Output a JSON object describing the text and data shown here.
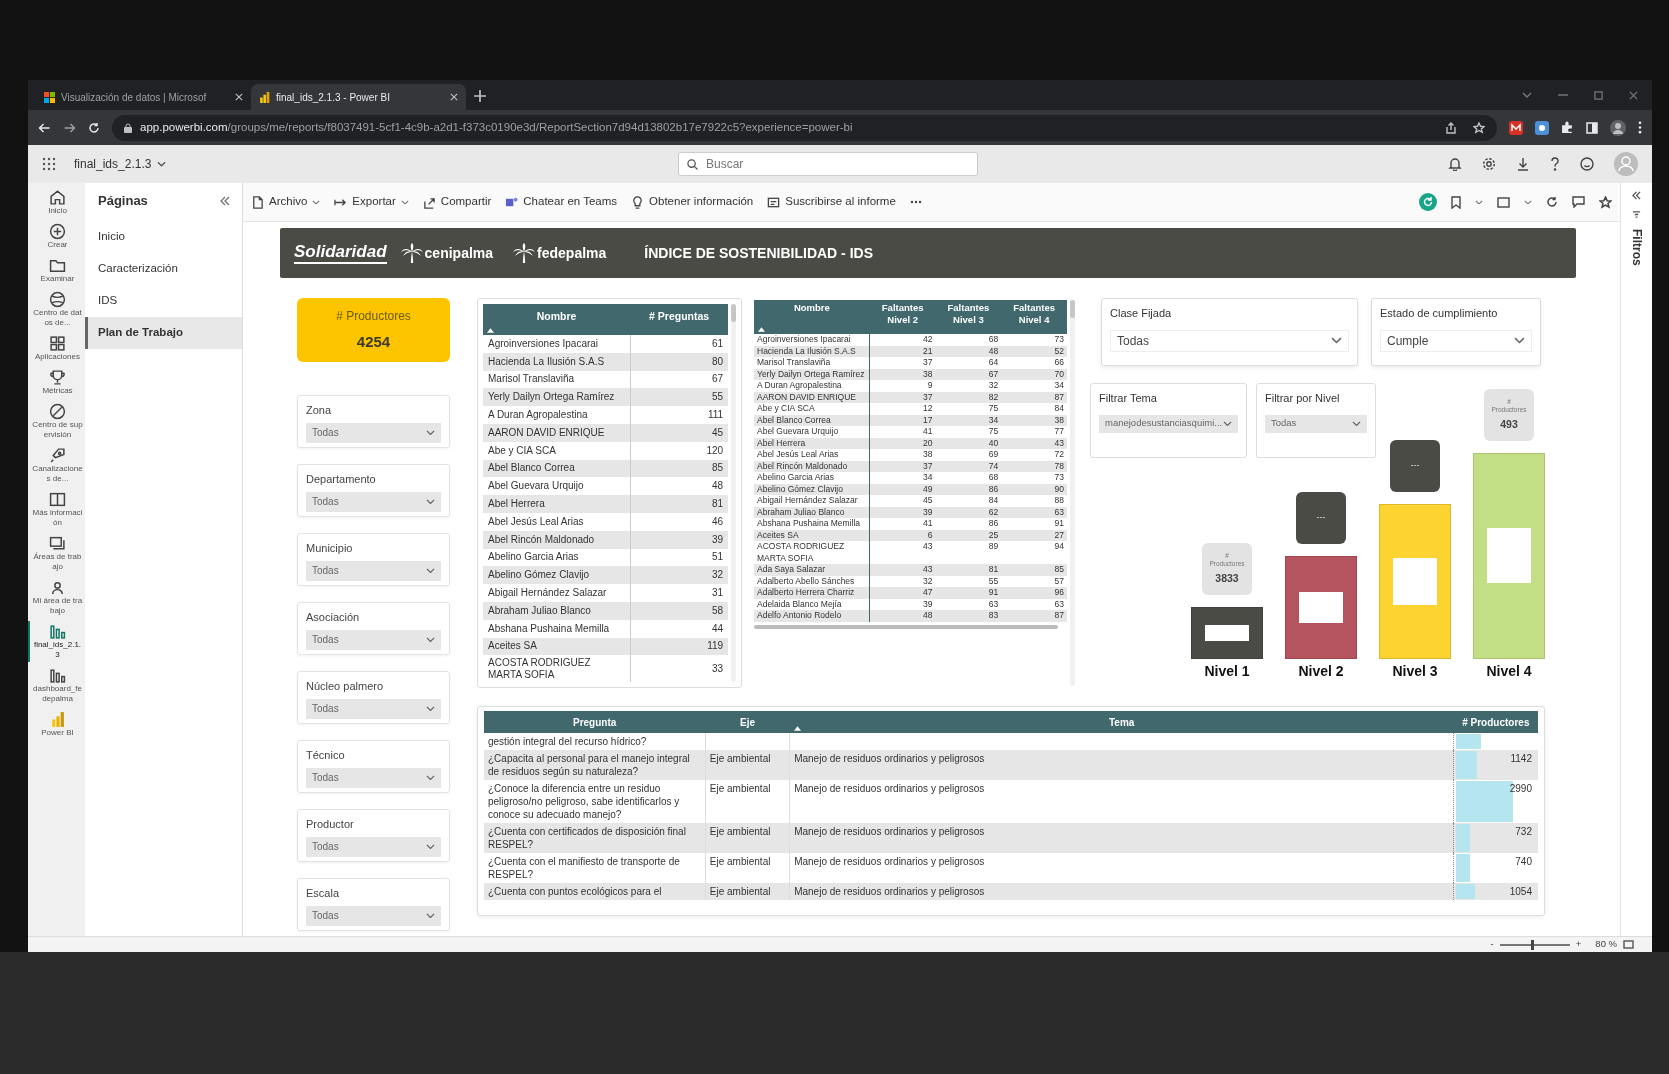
{
  "browser": {
    "tabs": [
      {
        "title": "Visualización de datos | Microsof",
        "selected": false
      },
      {
        "title": "final_ids_2.1.3 - Power BI",
        "selected": true
      }
    ],
    "address": {
      "host": "app.powerbi.com",
      "path": "/groups/me/reports/f8037491-5cf1-4c9b-a2d1-f373c0190e3d/ReportSection7d94d13802b17e7922c5?experience=power-bi"
    }
  },
  "app_header": {
    "report_title": "final_ids_2.1.3",
    "search": {
      "placeholder": "Buscar"
    }
  },
  "nav_rail": [
    {
      "label": "Inicio",
      "selected": false
    },
    {
      "label": "Crear",
      "selected": false
    },
    {
      "label": "Examinar",
      "selected": false
    },
    {
      "label": "Centro de datos de...",
      "selected": false
    },
    {
      "label": "Aplicaciones",
      "selected": false
    },
    {
      "label": "Métricas",
      "selected": false
    },
    {
      "label": "Centro de supervisión",
      "selected": false
    },
    {
      "label": "Canalizaciones de...",
      "selected": false
    },
    {
      "label": "Más información",
      "selected": false
    },
    {
      "label": "Áreas de trabajo",
      "selected": false
    },
    {
      "label": "Mi área de trabajo",
      "selected": false
    },
    {
      "label": "final_ids_2.1.3",
      "selected": true
    },
    {
      "label": "dashboard_fedepalma",
      "selected": false
    },
    {
      "label": "Power BI",
      "selected": false
    }
  ],
  "pages": {
    "title": "Páginas",
    "items": [
      {
        "label": "Inicio",
        "selected": false
      },
      {
        "label": "Caracterización",
        "selected": false
      },
      {
        "label": "IDS",
        "selected": false
      },
      {
        "label": "Plan de Trabajo",
        "selected": true
      }
    ]
  },
  "toolbar": [
    {
      "label": "Archivo",
      "dropdown": true
    },
    {
      "label": "Exportar",
      "dropdown": true
    },
    {
      "label": "Compartir",
      "dropdown": false
    },
    {
      "label": "Chatear en Teams",
      "dropdown": false
    },
    {
      "label": "Obtener información",
      "dropdown": false
    },
    {
      "label": "Suscribirse al informe",
      "dropdown": false
    }
  ],
  "report": {
    "brands": [
      "Solidaridad",
      "cenipalma",
      "fedepalma"
    ],
    "title": "ÍNDICE DE SOSTENIBILIDAD - IDS",
    "kpi": {
      "label": "# Productores",
      "value": "4254"
    },
    "left_slicers": [
      {
        "label": "Zona",
        "value": "Todas"
      },
      {
        "label": "Departamento",
        "value": "Todas"
      },
      {
        "label": "Municipio",
        "value": "Todas"
      },
      {
        "label": "Asociación",
        "value": "Todas"
      },
      {
        "label": "Núcleo palmero",
        "value": "Todas"
      },
      {
        "label": "Técnico",
        "value": "Todas"
      },
      {
        "label": "Productor",
        "value": "Todas"
      },
      {
        "label": "Escala",
        "value": "Todas"
      }
    ],
    "questions_table": {
      "columns": [
        {
          "label": "Nombre",
          "sorted": true
        },
        {
          "label": "# Preguntas",
          "sorted": false
        }
      ],
      "rows": [
        [
          "Agroinversiones Ipacarai",
          "61"
        ],
        [
          "Hacienda La Ilusión S.A.S",
          "80"
        ],
        [
          "Marisol Translaviña",
          "67"
        ],
        [
          "Yerly Dailyn Ortega Ramírez",
          "55"
        ],
        [
          "A Duran Agropalestina",
          "111"
        ],
        [
          "AARON DAVID ENRIQUE",
          "45"
        ],
        [
          "Abe y CIA SCA",
          "120"
        ],
        [
          "Abel Blanco Correa",
          "85"
        ],
        [
          "Abel Guevara Urquijo",
          "48"
        ],
        [
          "Abel Herrera",
          "81"
        ],
        [
          "Abel Jesús Leal Arias",
          "46"
        ],
        [
          "Abel Rincón Maldonado",
          "39"
        ],
        [
          "Abelino Garcia Arias",
          "51"
        ],
        [
          "Abelino Gómez Clavijo",
          "32"
        ],
        [
          "Abigail Hernández Salazar",
          "31"
        ],
        [
          "Abraham Juliao Blanco",
          "58"
        ],
        [
          "Abshana Pushaina Memilla",
          "44"
        ],
        [
          "Aceites SA",
          "119"
        ],
        [
          "ACOSTA RODRIGUEZ MARTA SOFIA",
          "33"
        ]
      ]
    },
    "missing_table": {
      "columns": [
        {
          "label": "Nombre",
          "sorted": true
        },
        {
          "label": "Faltantes Nivel 2",
          "sorted": false
        },
        {
          "label": "Faltantes Nivel 3",
          "sorted": false
        },
        {
          "label": "Faltantes Nivel 4",
          "sorted": false
        }
      ],
      "rows": [
        [
          "Agroinversiones Ipacarai",
          "42",
          "68",
          "73"
        ],
        [
          "Hacienda La Ilusión S.A.S",
          "21",
          "48",
          "52"
        ],
        [
          "Marisol Translaviña",
          "37",
          "64",
          "66"
        ],
        [
          "Yerly Dailyn Ortega Ramírez",
          "38",
          "67",
          "70"
        ],
        [
          "A Duran Agropalestina",
          "9",
          "32",
          "34"
        ],
        [
          "AARON DAVID ENRIQUE",
          "37",
          "82",
          "87"
        ],
        [
          "Abe y CIA SCA",
          "12",
          "75",
          "84"
        ],
        [
          "Abel Blanco Correa",
          "17",
          "34",
          "38"
        ],
        [
          "Abel Guevara Urquijo",
          "41",
          "75",
          "77"
        ],
        [
          "Abel Herrera",
          "20",
          "40",
          "43"
        ],
        [
          "Abel Jesús Leal Arias",
          "38",
          "69",
          "72"
        ],
        [
          "Abel Rincón Maldonado",
          "37",
          "74",
          "78"
        ],
        [
          "Abelino Garcia Arias",
          "34",
          "68",
          "73"
        ],
        [
          "Abelino Gómez Clavijo",
          "49",
          "86",
          "90"
        ],
        [
          "Abigail Hernández Salazar",
          "45",
          "84",
          "88"
        ],
        [
          "Abraham Juliao Blanco",
          "39",
          "62",
          "63"
        ],
        [
          "Abshana Pushaina Memilla",
          "41",
          "86",
          "91"
        ],
        [
          "Aceites SA",
          "6",
          "25",
          "27"
        ],
        [
          "ACOSTA RODRIGUEZ MARTA SOFIA",
          "43",
          "89",
          "94"
        ],
        [
          "Ada Saya Salazar",
          "43",
          "81",
          "85"
        ],
        [
          "Adalberto Abello Sánches",
          "32",
          "55",
          "57"
        ],
        [
          "Adalberto Herrera Charriz",
          "47",
          "91",
          "96"
        ],
        [
          "Adelaida Blanco Mejía",
          "39",
          "63",
          "63"
        ],
        [
          "Adelfo Antonio Rodelo",
          "48",
          "83",
          "87"
        ]
      ]
    },
    "top_slicers": [
      {
        "label": "Clase Fijada",
        "value": "Todas"
      },
      {
        "label": "Estado de cumplimiento",
        "value": "Cumple"
      }
    ],
    "chart_slicers": [
      {
        "label": "Filtrar Tema",
        "value": "manejodesustanciasquimi..."
      },
      {
        "label": "Filtrar por Nivel",
        "value": "Todas"
      }
    ],
    "levels": [
      {
        "label": "Nivel 1",
        "color": "#4b4b45",
        "card": {
          "kind": "count",
          "caption": "#",
          "caption2": "Productores",
          "value": "3833"
        }
      },
      {
        "label": "Nivel 2",
        "color": "#b5535e",
        "card": {
          "kind": "empty",
          "value": "---"
        }
      },
      {
        "label": "Nivel 3",
        "color": "#fdd331",
        "card": {
          "kind": "empty",
          "value": "---"
        }
      },
      {
        "label": "Nivel 4",
        "color": "#c2df85",
        "card": {
          "kind": "count",
          "caption": "#",
          "caption2": "Productores",
          "value": "493"
        }
      }
    ],
    "topics_table": {
      "columns": [
        {
          "label": "Pregunta",
          "sorted": false
        },
        {
          "label": "Eje",
          "sorted": false
        },
        {
          "label": "Tema",
          "sorted": true
        },
        {
          "label": "# Productores",
          "sorted": false
        }
      ],
      "rows": [
        {
          "question": "gestión integral del recurso hídrico?",
          "level": 0.3
        },
        {
          "question": "¿Capacita al personal para el manejo integral de residuos según su naturaleza?",
          "axis": "Eje ambiental",
          "topic": "Manejo de residuos ordinarios y peligrosos",
          "count": "1142",
          "level": 0.25
        },
        {
          "question": "¿Conoce la diferencia entre un residuo peligroso/no peligroso, sabe identificarlos y conoce su adecuado manejo?",
          "axis": "Eje ambiental",
          "topic": "Manejo de residuos ordinarios y peligrosos",
          "count": "2990",
          "level": 0.68
        },
        {
          "question": "¿Cuenta con certificados de disposición final RESPEL?",
          "axis": "Eje ambiental",
          "topic": "Manejo de residuos ordinarios y peligrosos",
          "count": "732",
          "level": 0.17
        },
        {
          "question": "¿Cuenta con el manifiesto de transporte de RESPEL?",
          "axis": "Eje ambiental",
          "topic": "Manejo de residuos ordinarios y peligrosos",
          "count": "740",
          "level": 0.17
        },
        {
          "question": "¿Cuenta con puntos ecológicos para el",
          "axis": "Eje ambiental",
          "topic": "Manejo de residuos ordinarios y peligrosos",
          "count": "1054",
          "level": 0.23
        }
      ]
    }
  },
  "filters_pane": {
    "label": "Filtros"
  },
  "status_bar": {
    "zoom_out": "-",
    "zoom_in": "+",
    "zoom": "80 %",
    "zoom_slider": {
      "level": 0.45
    }
  }
}
